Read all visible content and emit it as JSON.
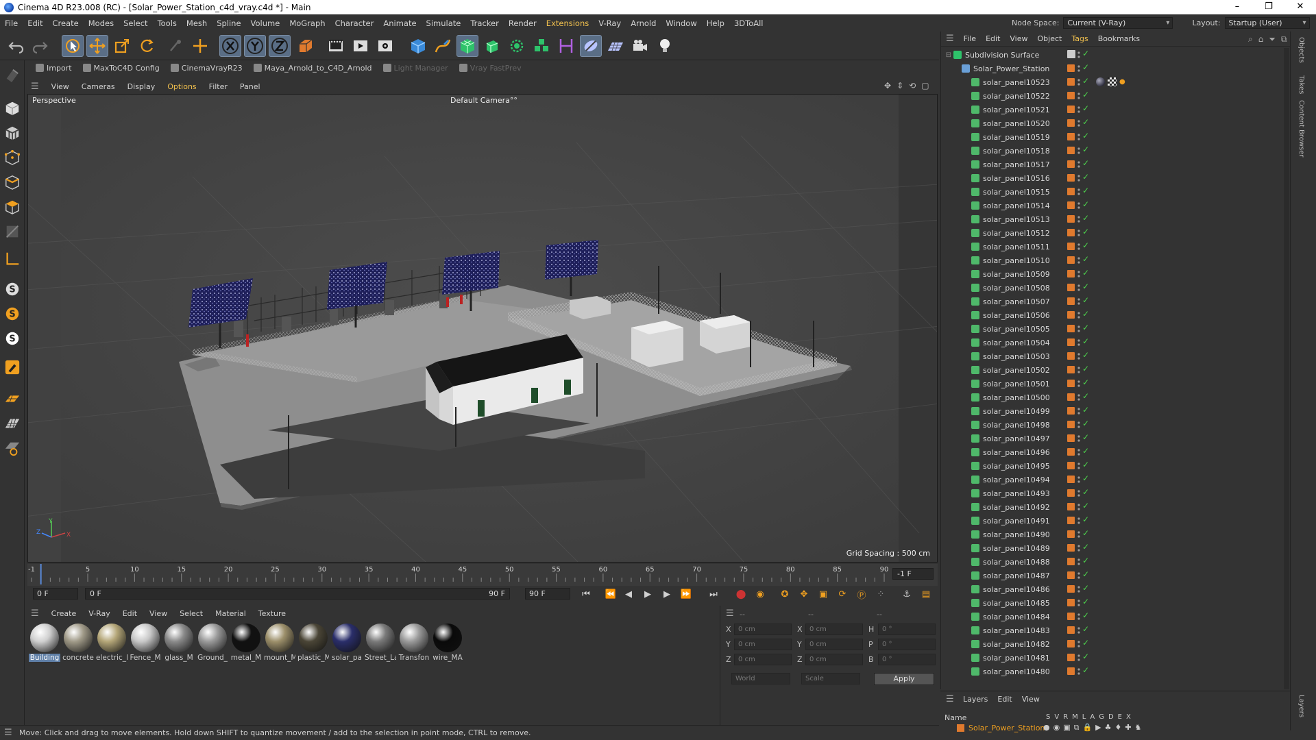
{
  "window": {
    "title": "Cinema 4D R23.008 (RC) - [Solar_Power_Station_c4d_vray.c4d *] - Main",
    "controls": [
      "–",
      "❐",
      "✕"
    ]
  },
  "menubar": {
    "items": [
      {
        "label": "File"
      },
      {
        "label": "Edit"
      },
      {
        "label": "Create"
      },
      {
        "label": "Modes"
      },
      {
        "label": "Select"
      },
      {
        "label": "Tools"
      },
      {
        "label": "Mesh"
      },
      {
        "label": "Spline"
      },
      {
        "label": "Volume"
      },
      {
        "label": "MoGraph"
      },
      {
        "label": "Character"
      },
      {
        "label": "Animate"
      },
      {
        "label": "Simulate"
      },
      {
        "label": "Tracker"
      },
      {
        "label": "Render"
      },
      {
        "label": "Extensions",
        "highlight": true
      },
      {
        "label": "V-Ray"
      },
      {
        "label": "Arnold"
      },
      {
        "label": "Window"
      },
      {
        "label": "Help"
      },
      {
        "label": "3DToAll"
      }
    ],
    "node_space_label": "Node Space:",
    "node_space_value": "Current (V-Ray)",
    "layout_label": "Layout:",
    "layout_value": "Startup (User)"
  },
  "plugins": [
    {
      "label": "Import",
      "disabled": false
    },
    {
      "label": "MaxToC4D Config",
      "disabled": false
    },
    {
      "label": "CinemaVrayR23",
      "disabled": false
    },
    {
      "label": "Maya_Arnold_to_C4D_Arnold",
      "disabled": false
    },
    {
      "label": "Light Manager",
      "disabled": true
    },
    {
      "label": "Vray FastPrev",
      "disabled": true
    }
  ],
  "viewport": {
    "menu": [
      {
        "label": "View"
      },
      {
        "label": "Cameras"
      },
      {
        "label": "Display"
      },
      {
        "label": "Options",
        "highlight": true
      },
      {
        "label": "Filter"
      },
      {
        "label": "Panel"
      }
    ],
    "projection": "Perspective",
    "camera": "Default Camera",
    "camera_suffix": "°°",
    "grid_spacing": "Grid Spacing : 500 cm",
    "axis_labels": {
      "y": "Y",
      "z": "Z",
      "x": "X"
    }
  },
  "timeline": {
    "ticks": [
      "-1",
      "5",
      "10",
      "15",
      "20",
      "25",
      "30",
      "35",
      "40",
      "45",
      "50",
      "55",
      "60",
      "65",
      "70",
      "75",
      "80",
      "85",
      "90"
    ],
    "current_end": "-1 F",
    "start_field": "0 F",
    "range_start": "0 F",
    "range_end": "90 F",
    "end_field": "90 F"
  },
  "materials": {
    "menu": [
      {
        "label": "Create"
      },
      {
        "label": "V-Ray"
      },
      {
        "label": "Edit"
      },
      {
        "label": "View"
      },
      {
        "label": "Select"
      },
      {
        "label": "Material"
      },
      {
        "label": "Texture"
      }
    ],
    "items": [
      {
        "label": "Building",
        "color": "#d0d0d0",
        "selected": true
      },
      {
        "label": "concrete",
        "color": "#a09a88"
      },
      {
        "label": "electric_l",
        "color": "#b4a678"
      },
      {
        "label": "Fence_M",
        "color": "#c8c8c8"
      },
      {
        "label": "glass_M",
        "color": "#8a8a8a"
      },
      {
        "label": "Ground_",
        "color": "#9a9a9a"
      },
      {
        "label": "metal_M",
        "color": "#111111"
      },
      {
        "label": "mount_M",
        "color": "#9c8f6a"
      },
      {
        "label": "plastic_M",
        "color": "#4a4536"
      },
      {
        "label": "solar_pa",
        "color": "#2a2e6a"
      },
      {
        "label": "Street_La",
        "color": "#7a7a7a"
      },
      {
        "label": "Transfon",
        "color": "#9a9a9a"
      },
      {
        "label": "wire_MA",
        "color": "#0a0a0a"
      }
    ]
  },
  "coords": {
    "header": [
      "--",
      "--",
      "--"
    ],
    "rows": [
      {
        "a": "X",
        "av": "0 cm",
        "b": "X",
        "bv": "0 cm",
        "c": "H",
        "cv": "0 °"
      },
      {
        "a": "Y",
        "av": "0 cm",
        "b": "Y",
        "bv": "0 cm",
        "c": "P",
        "cv": "0 °"
      },
      {
        "a": "Z",
        "av": "0 cm",
        "b": "Z",
        "bv": "0 cm",
        "c": "B",
        "cv": "0 °"
      }
    ],
    "mode1": "World",
    "mode2": "Scale",
    "apply": "Apply"
  },
  "objects": {
    "menu": [
      {
        "label": "File"
      },
      {
        "label": "Edit"
      },
      {
        "label": "View"
      },
      {
        "label": "Object"
      },
      {
        "label": "Tags",
        "highlight": true
      },
      {
        "label": "Bookmarks"
      }
    ],
    "root": "Subdivision Surface",
    "group": "Solar_Power_Station",
    "items": [
      "solar_panel10523",
      "solar_panel10522",
      "solar_panel10521",
      "solar_panel10520",
      "solar_panel10519",
      "solar_panel10518",
      "solar_panel10517",
      "solar_panel10516",
      "solar_panel10515",
      "solar_panel10514",
      "solar_panel10513",
      "solar_panel10512",
      "solar_panel10511",
      "solar_panel10510",
      "solar_panel10509",
      "solar_panel10508",
      "solar_panel10507",
      "solar_panel10506",
      "solar_panel10505",
      "solar_panel10504",
      "solar_panel10503",
      "solar_panel10502",
      "solar_panel10501",
      "solar_panel10500",
      "solar_panel10499",
      "solar_panel10498",
      "solar_panel10497",
      "solar_panel10496",
      "solar_panel10495",
      "solar_panel10494",
      "solar_panel10493",
      "solar_panel10492",
      "solar_panel10491",
      "solar_panel10490",
      "solar_panel10489",
      "solar_panel10488",
      "solar_panel10487",
      "solar_panel10486",
      "solar_panel10485",
      "solar_panel10484",
      "solar_panel10483",
      "solar_panel10482",
      "solar_panel10481",
      "solar_panel10480"
    ]
  },
  "layers": {
    "menu": [
      {
        "label": "Layers"
      },
      {
        "label": "Edit"
      },
      {
        "label": "View"
      }
    ],
    "name_header": "Name",
    "col_headers": [
      "S",
      "V",
      "R",
      "M",
      "L",
      "A",
      "G",
      "D",
      "E",
      "X"
    ],
    "layer_name": "Solar_Power_Station",
    "layer_color": "#e07a2e"
  },
  "right_tabs": [
    "Objects",
    "Takes",
    "Content Browser",
    "Layers"
  ],
  "status": "Move: Click and drag to move elements. Hold down SHIFT to quantize movement / add to the selection in point mode, CTRL to remove."
}
